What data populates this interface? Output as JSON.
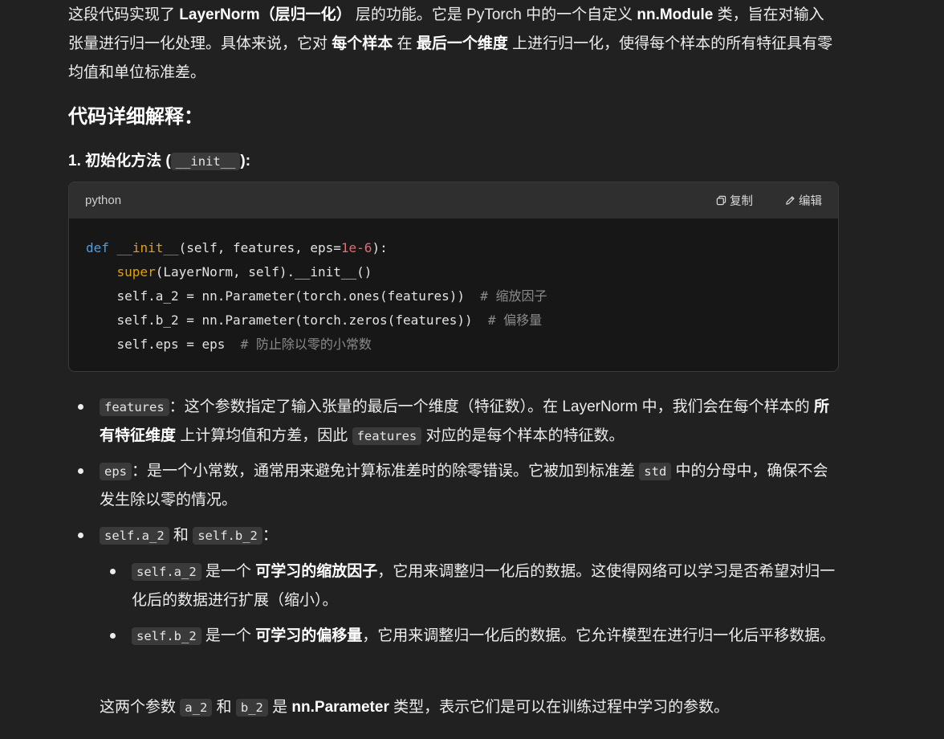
{
  "intro": {
    "t1": "这段代码实现了 ",
    "b1": "LayerNorm（层归一化）",
    "t2": " 层的功能。它是 PyTorch 中的一个自定义 ",
    "b2": "nn.Module",
    "t3": " 类，旨在对输入张量进行归一化处理。具体来说，它对 ",
    "b3": "每个样本",
    "t4": " 在 ",
    "b4": "最后一个维度",
    "t5": " 上进行归一化，使得每个样本的所有特征具有零均值和单位标准差。"
  },
  "heading": "代码详细解释：",
  "subheading": {
    "prefix": "1. 初始化方法 (",
    "code": "__init__",
    "suffix": "):"
  },
  "codeblock": {
    "language": "python",
    "copy_label": "复制",
    "edit_label": "编辑",
    "copy_icon": "copy-icon",
    "edit_icon": "pencil-icon"
  },
  "bullets": {
    "features": {
      "code": "features",
      "t1": "：这个参数指定了输入张量的最后一个维度（特征数）。在 LayerNorm 中，我们会在每个样本的 ",
      "b1": "所有特征维度",
      "t2": " 上计算均值和方差，因此 ",
      "code2": "features",
      "t3": " 对应的是每个样本的特征数。"
    },
    "eps": {
      "code": "eps",
      "t1": "：是一个小常数，通常用来避免计算标准差时的除零错误。它被加到标准差 ",
      "code2": "std",
      "t2": " 中的分母中，确保不会发生除以零的情况。"
    },
    "ab": {
      "code1": "self.a_2",
      "t1": " 和 ",
      "code2": "self.b_2",
      "t2": "："
    },
    "a2": {
      "code": "self.a_2",
      "t1": " 是一个 ",
      "b1": "可学习的缩放因子",
      "t2": "，它用来调整归一化后的数据。这使得网络可以学习是否希望对归一化后的数据进行扩展（缩小）。"
    },
    "b2": {
      "code": "self.b_2",
      "t1": " 是一个 ",
      "b1": "可学习的偏移量",
      "t2": "，它用来调整归一化后的数据。它允许模型在进行归一化后平移数据。"
    }
  },
  "final": {
    "t1": "这两个参数 ",
    "c1": "a_2",
    "t2": " 和 ",
    "c2": "b_2",
    "t3": " 是 ",
    "b1": "nn.Parameter",
    "t4": " 类型，表示它们是可以在训练过程中学习的参数。"
  }
}
